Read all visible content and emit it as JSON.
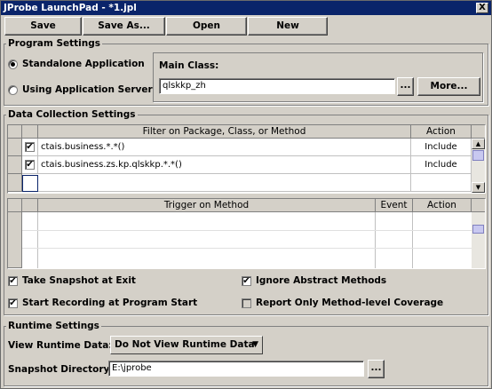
{
  "window": {
    "title": "JProbe LaunchPad - *1.jpl",
    "close_glyph": "X"
  },
  "toolbar": {
    "save": "Save",
    "save_as": "Save As...",
    "open": "Open",
    "new": "New"
  },
  "program_settings": {
    "label": "Program Settings",
    "standalone": "Standalone Application",
    "app_server": "Using Application Server",
    "main_class_label": "Main Class:",
    "main_class_value": "qlskkp_zh",
    "browse": "...",
    "more": "More...",
    "selected_mode": "standalone"
  },
  "data_collection": {
    "label": "Data Collection Settings",
    "filter_headers": {
      "filter": "Filter on Package, Class, or Method",
      "action": "Action"
    },
    "filters": [
      {
        "checked": "✔",
        "filter": "ctais.business.*.*()",
        "action": "Include"
      },
      {
        "checked": "✔",
        "filter": "ctais.business.zs.kp.qlskkp.*.*()",
        "action": "Include"
      }
    ],
    "trigger_headers": {
      "trigger": "Trigger on Method",
      "event": "Event",
      "action": "Action"
    },
    "options": {
      "take_snapshot": "Take Snapshot at Exit",
      "start_recording": "Start Recording at Program Start",
      "ignore_abstract": "Ignore Abstract Methods",
      "report_method": "Report Only Method-level Coverage",
      "check": "✔"
    }
  },
  "runtime": {
    "label": "Runtime Settings",
    "view_label": "View Runtime Data:",
    "view_value": "Do Not View Runtime Data",
    "snapshot_label": "Snapshot Directory:",
    "snapshot_value": "E:\\jprobe",
    "browse": "..."
  },
  "icons": {
    "scroll_up": "▲",
    "scroll_down": "▼",
    "dropdown": "▼"
  }
}
